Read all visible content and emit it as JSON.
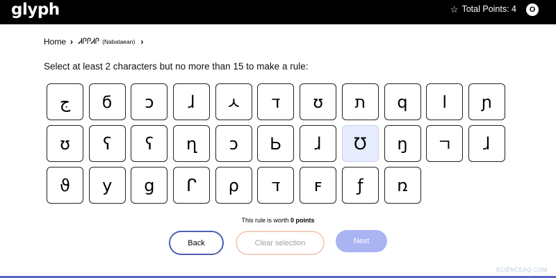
{
  "header": {
    "logo_text": "glyph",
    "points_label": "Total Points: 4",
    "avatar_initial": "O",
    "star_icon": "star-outline-icon"
  },
  "breadcrumb": {
    "home": "Home",
    "script_name": "ᏗᎵᎵᏗᎵ",
    "script_language": "(Nabataean)"
  },
  "instruction": "Select at least 2 characters but no more than 15 to make a rule:",
  "characters": [
    {
      "glyph": "ج",
      "selected": false
    },
    {
      "glyph": "ϭ",
      "selected": false
    },
    {
      "glyph": "ɔ",
      "selected": false
    },
    {
      "glyph": "ɺ",
      "selected": false
    },
    {
      "glyph": "ㅅ",
      "selected": false
    },
    {
      "glyph": "ד",
      "selected": false
    },
    {
      "glyph": "ʊ",
      "selected": false
    },
    {
      "glyph": "ת",
      "selected": false
    },
    {
      "glyph": "q",
      "selected": false
    },
    {
      "glyph": "ا",
      "selected": false
    },
    {
      "glyph": "ɲ",
      "selected": false
    },
    {
      "glyph": "ʊ",
      "selected": false
    },
    {
      "glyph": "ʕ",
      "selected": false
    },
    {
      "glyph": "ʕ",
      "selected": false
    },
    {
      "glyph": "ղ",
      "selected": false
    },
    {
      "glyph": "ɔ",
      "selected": false
    },
    {
      "glyph": "Ꮟ",
      "selected": false
    },
    {
      "glyph": "ɺ",
      "selected": false
    },
    {
      "glyph": "Ʊ",
      "selected": true
    },
    {
      "glyph": "ŋ",
      "selected": false
    },
    {
      "glyph": "ㄱ",
      "selected": false
    },
    {
      "glyph": "ɺ",
      "selected": false
    },
    {
      "glyph": "ϑ",
      "selected": false
    },
    {
      "glyph": "y",
      "selected": false
    },
    {
      "glyph": "ց",
      "selected": false
    },
    {
      "glyph": "ᒋ",
      "selected": false
    },
    {
      "glyph": "ρ",
      "selected": false
    },
    {
      "glyph": "ד",
      "selected": false
    },
    {
      "glyph": "ꜰ",
      "selected": false
    },
    {
      "glyph": "ƒ",
      "selected": false
    },
    {
      "glyph": "ռ",
      "selected": false
    }
  ],
  "rule_worth": {
    "prefix": "This rule is worth ",
    "points": "0 points"
  },
  "buttons": {
    "back": "Back",
    "clear": "Clear selection",
    "next": "Next"
  },
  "watermark": "SCIENCEAQ.COM",
  "colors": {
    "header_bg": "#000000",
    "selected_tile_bg": "#e6ecfb",
    "back_border": "#4c5fb0",
    "clear_border": "#f3d0bd",
    "next_bg": "#aab4f3"
  }
}
